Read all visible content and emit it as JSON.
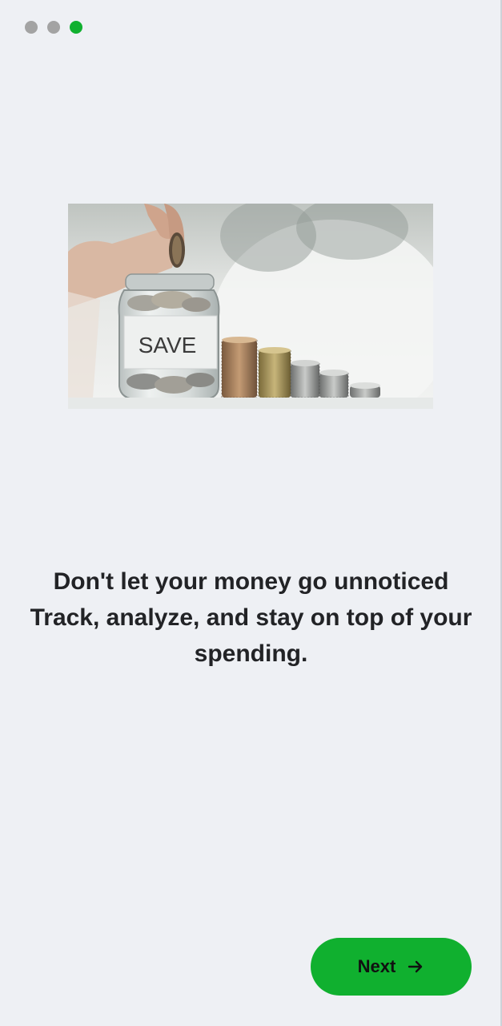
{
  "pagination": {
    "total": 3,
    "active_index": 3,
    "active_color": "#10b02f",
    "inactive_color": "#a3a3a3"
  },
  "hero": {
    "jar_label": "SAVE",
    "image_desc_icon": "savings-jar-illustration"
  },
  "headline": {
    "line1": "Don't let your money go unnoticed",
    "line2": "Track, analyze, and stay on top of your",
    "line3": "spending."
  },
  "next_button": {
    "label": "Next",
    "icon": "arrow-right-icon",
    "color": "#10b02f"
  }
}
